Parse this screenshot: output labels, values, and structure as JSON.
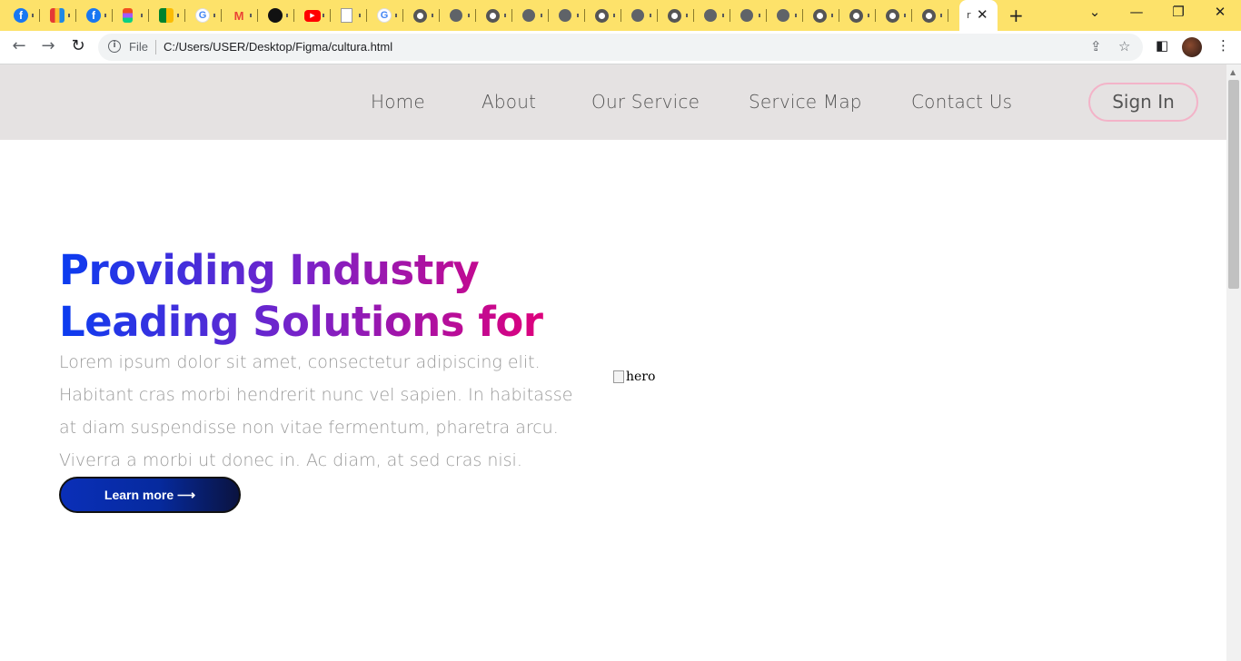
{
  "browser": {
    "tabs": [
      {
        "icon": "facebook-icon",
        "glyph": "f"
      },
      {
        "icon": "trello-icon",
        "glyph": ""
      },
      {
        "icon": "facebook-icon",
        "glyph": "f"
      },
      {
        "icon": "figma-icon",
        "glyph": ""
      },
      {
        "icon": "google-meet-icon",
        "glyph": ""
      },
      {
        "icon": "google-icon",
        "glyph": "G"
      },
      {
        "icon": "gmail-icon",
        "glyph": "M"
      },
      {
        "icon": "github-icon",
        "glyph": ""
      },
      {
        "icon": "youtube-icon",
        "glyph": "▶"
      },
      {
        "icon": "document-icon",
        "glyph": ""
      },
      {
        "icon": "google-icon",
        "glyph": "G"
      },
      {
        "icon": "chrome-icon",
        "glyph": ""
      },
      {
        "icon": "globe-icon",
        "glyph": ""
      },
      {
        "icon": "chrome-icon",
        "glyph": ""
      },
      {
        "icon": "globe-icon",
        "glyph": ""
      },
      {
        "icon": "globe-icon",
        "glyph": ""
      },
      {
        "icon": "chrome-icon",
        "glyph": ""
      },
      {
        "icon": "globe-icon",
        "glyph": ""
      },
      {
        "icon": "chrome-icon",
        "glyph": ""
      },
      {
        "icon": "globe-icon",
        "glyph": ""
      },
      {
        "icon": "globe-icon",
        "glyph": ""
      },
      {
        "icon": "globe-icon",
        "glyph": ""
      },
      {
        "icon": "chrome-icon",
        "glyph": ""
      },
      {
        "icon": "chrome-icon",
        "glyph": ""
      },
      {
        "icon": "chrome-icon",
        "glyph": ""
      },
      {
        "icon": "chrome-icon",
        "glyph": ""
      }
    ],
    "active_tab_text": "r",
    "close_glyph": "✕",
    "new_tab_glyph": "+",
    "tab_search_glyph": "⌄",
    "minimize_glyph": "—",
    "restore_glyph": "❐",
    "window_close_glyph": "✕",
    "back_glyph": "←",
    "forward_glyph": "→",
    "reload_glyph": "↻",
    "info_glyph": "i",
    "file_label": "File",
    "url": "C:/Users/USER/Desktop/Figma/cultura.html",
    "share_glyph": "⇪",
    "star_glyph": "☆",
    "sidepanel_glyph": "◧",
    "menu_glyph": "⋮",
    "accent_color": "#fde26a"
  },
  "site": {
    "nav": {
      "links": [
        "Home",
        "About",
        "Our Service",
        "Service Map",
        "Contact Us"
      ],
      "sign_in": "Sign In"
    },
    "hero": {
      "title_line1": "Providing Industry",
      "title_line2": "Leading Solutions for",
      "body": "Lorem ipsum dolor sit amet, consectetur adipiscing elit. Habitant cras morbi hendrerit nunc vel sapien. In habitasse at diam suspendisse non vitae fermentum, pharetra arcu. Viverra a morbi ut donec in. Ac diam, at sed cras nisi.",
      "button": "Learn more ⟶",
      "image_alt": "hero"
    },
    "colors": {
      "nav_bg": "#e5e2e2",
      "title_gradient_start": "#0a3cf0",
      "title_gradient_end": "#e0007a",
      "signin_border": "#f3b3c8",
      "button_bg": "#062a9e"
    }
  }
}
